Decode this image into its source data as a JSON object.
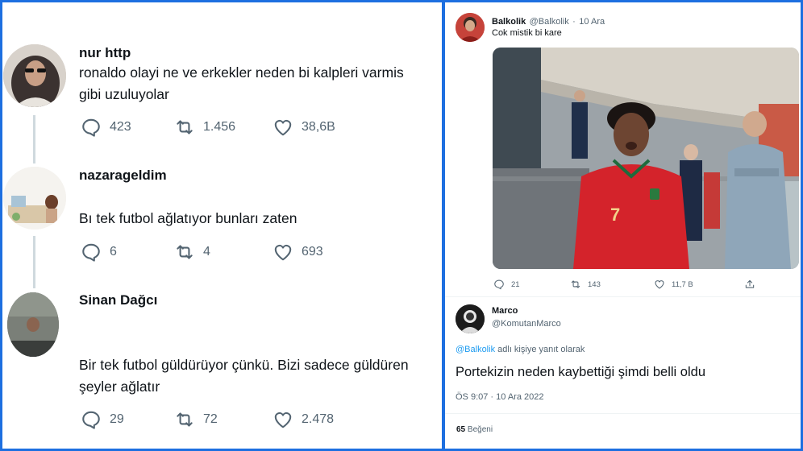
{
  "left_thread": {
    "tweets": [
      {
        "name": "nur http",
        "text_lines": [
          "ronaldo olayi ne ve erkekler neden bi kalpleri varmis",
          "gibi uzuluyolar"
        ],
        "replies": "423",
        "retweets": "1.456",
        "likes": "38,6B"
      },
      {
        "name": "nazarageldim",
        "text_lines": [
          "Bı tek futbol ağlatıyor bunları zaten"
        ],
        "replies": "6",
        "retweets": "4",
        "likes": "693"
      },
      {
        "name": "Sinan Dağcı",
        "text_lines": [
          "Bir tek futbol güldürüyor çünkü. Bizi sadece güldüren",
          "şeyler ağlatır"
        ],
        "replies": "29",
        "retweets": "72",
        "likes": "2.478"
      }
    ]
  },
  "right_panel": {
    "tweet": {
      "name": "Balkolik",
      "handle": "@Balkolik",
      "separator": "·",
      "date": "10 Ara",
      "text": "Cok mistik bi kare",
      "jersey_number": "7",
      "replies": "21",
      "retweets": "143",
      "likes": "11,7 B"
    },
    "reply": {
      "name": "Marco",
      "handle": "@KomutanMarco",
      "reply_to_mention": "@Balkolik",
      "reply_to_suffix": " adlı kişiye yanıt olarak",
      "text": "Portekizin neden kaybettiği şimdi belli oldu",
      "timestamp": "ÖS 9:07 · 10 Ara 2022",
      "likes_count": "65",
      "likes_label": "Beğeni"
    }
  },
  "colors": {
    "frame": "#1d6fe0",
    "text": "#0f1419",
    "muted": "#536471",
    "link": "#1d9bf0",
    "divider": "#eff3f4"
  }
}
